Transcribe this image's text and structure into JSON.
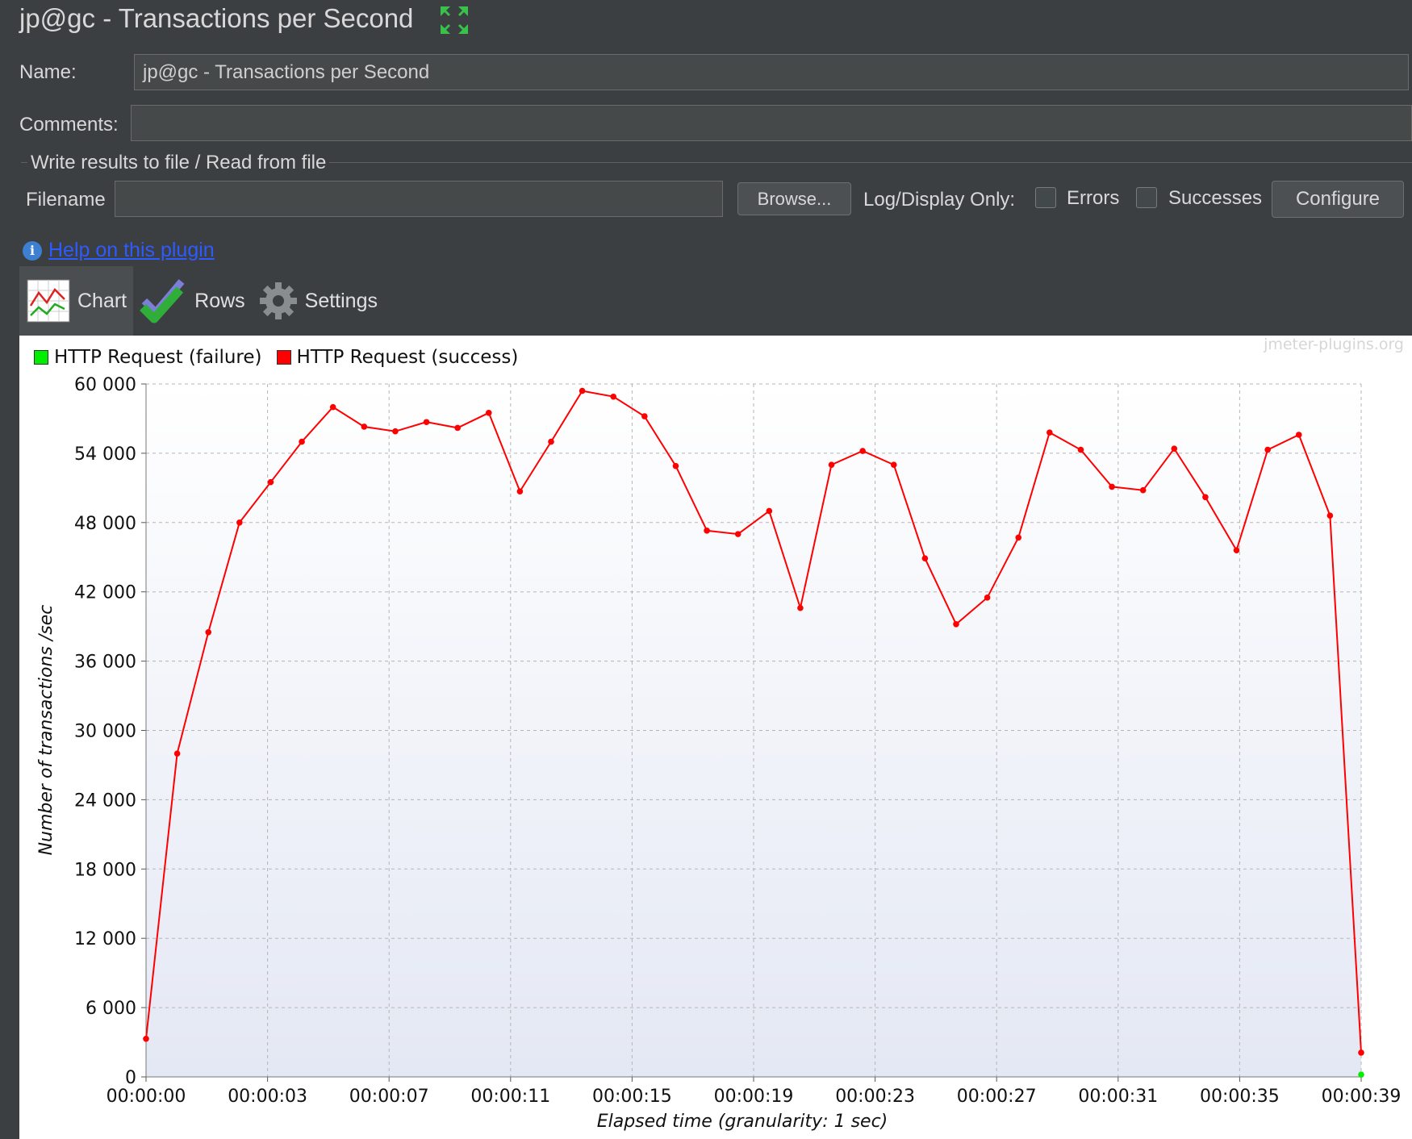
{
  "window": {
    "title": "jp@gc - Transactions per Second"
  },
  "form": {
    "name_label": "Name:",
    "name_value": "jp@gc - Transactions per Second",
    "comments_label": "Comments:",
    "comments_value": ""
  },
  "file_group": {
    "title": "Write results to file / Read from file",
    "filename_label": "Filename",
    "filename_value": "",
    "browse_label": "Browse...",
    "log_display_label": "Log/Display Only:",
    "errors_label": "Errors",
    "successes_label": "Successes",
    "configure_label": "Configure"
  },
  "help": {
    "label": "Help on this plugin"
  },
  "tabs": [
    {
      "label": "Chart",
      "icon": "chart-icon"
    },
    {
      "label": "Rows",
      "icon": "checkmark-icon"
    },
    {
      "label": "Settings",
      "icon": "gear-icon"
    }
  ],
  "watermark": "jmeter-plugins.org",
  "colors": {
    "success": "#ff0000",
    "failure": "#00ee00",
    "background": "#3c3f41"
  },
  "chart_data": {
    "type": "line",
    "xlabel": "Elapsed time (granularity: 1 sec)",
    "ylabel": "Number of transactions /sec",
    "ylim": [
      0,
      60000
    ],
    "yticks": [
      0,
      6000,
      12000,
      18000,
      24000,
      30000,
      36000,
      42000,
      48000,
      54000,
      60000
    ],
    "ytick_labels": [
      "0",
      "6 000",
      "12 000",
      "18 000",
      "24 000",
      "30 000",
      "36 000",
      "42 000",
      "48 000",
      "54 000",
      "60 000"
    ],
    "xlim": [
      0,
      39
    ],
    "xtick_labels": [
      "00:00:00",
      "00:00:03",
      "00:00:07",
      "00:00:11",
      "00:00:15",
      "00:00:19",
      "00:00:23",
      "00:00:27",
      "00:00:31",
      "00:00:35",
      "00:00:39"
    ],
    "grid": true,
    "legend_position": "top-left",
    "series": [
      {
        "name": "HTTP Request (failure)",
        "color": "#00ee00",
        "x": [
          39
        ],
        "values": [
          200
        ]
      },
      {
        "name": "HTTP Request (success)",
        "color": "#ff0000",
        "x": [
          0,
          1,
          2,
          3,
          4,
          5,
          6,
          7,
          8,
          9,
          10,
          11,
          12,
          13,
          14,
          15,
          16,
          17,
          18,
          19,
          20,
          21,
          22,
          23,
          24,
          25,
          26,
          27,
          28,
          29,
          30,
          31,
          32,
          33,
          34,
          35,
          36,
          37,
          38,
          39
        ],
        "values": [
          3300,
          28000,
          38500,
          48000,
          51500,
          55000,
          58000,
          56300,
          55900,
          56700,
          56200,
          57500,
          50700,
          55000,
          59400,
          58900,
          57200,
          52900,
          47300,
          47000,
          49000,
          40600,
          53000,
          54200,
          53000,
          44900,
          39200,
          41500,
          46700,
          55800,
          54300,
          51100,
          50800,
          54400,
          50200,
          45600,
          54300,
          55600,
          48600,
          2100
        ]
      }
    ]
  }
}
